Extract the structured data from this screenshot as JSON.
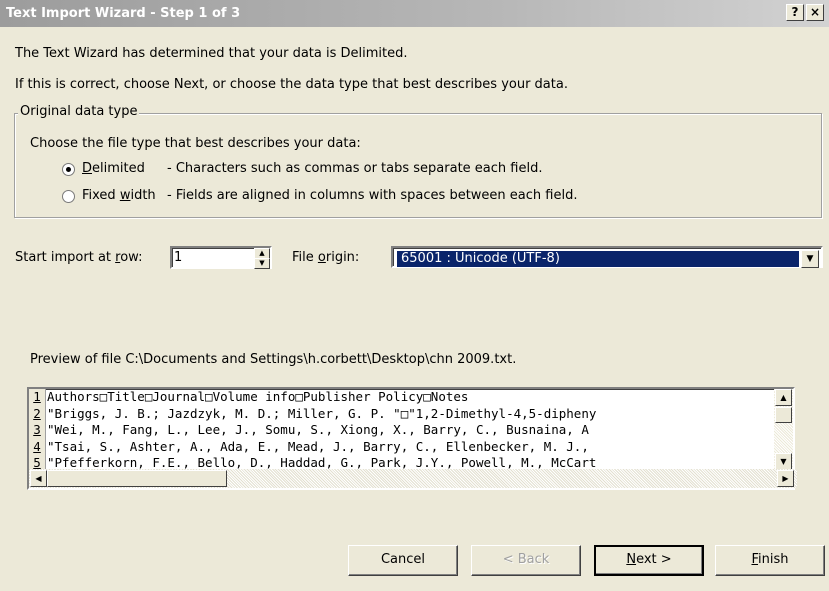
{
  "window": {
    "title": "Text Import Wizard - Step 1 of 3",
    "help_glyph": "?",
    "close_glyph": "×"
  },
  "intro": {
    "line1": "The Text Wizard has determined that your data is Delimited.",
    "line2": "If this is correct, choose Next, or choose the data type that best describes your data."
  },
  "original_data_type": {
    "legend": "Original data type",
    "prompt": "Choose the file type that best describes your data:",
    "options": [
      {
        "label_pre": "",
        "label_mnemonic": "D",
        "label_post": "elimited",
        "description": "- Characters such as commas or tabs separate each field.",
        "selected": true
      },
      {
        "label_pre": "Fixed ",
        "label_mnemonic": "w",
        "label_post": "idth",
        "description": "- Fields are aligned in columns with spaces between each field.",
        "selected": false
      }
    ]
  },
  "start_row": {
    "label_pre": "Start import at ",
    "label_mnemonic": "r",
    "label_post": "ow:",
    "value": "1"
  },
  "file_origin": {
    "label_pre": "File ",
    "label_mnemonic": "o",
    "label_post": "rigin:",
    "value": "65001 : Unicode (UTF-8)"
  },
  "preview": {
    "label": "Preview of file C:\\Documents and Settings\\h.corbett\\Desktop\\chn 2009.txt.",
    "rows": [
      {
        "num": "1",
        "text": "Authors□Title□Journal□Volume info□Publisher Policy□Notes"
      },
      {
        "num": "2",
        "text": "\"Briggs, J. B.; Jazdzyk, M. D.; Miller, G. P. \"□\"1,2-Dimethyl-4,5-dipheny"
      },
      {
        "num": "3",
        "text": "\"Wei, M., Fang, L., Lee, J., Somu, S., Xiong, X., Barry, C., Busnaina, A"
      },
      {
        "num": "4",
        "text": "\"Tsai, S., Ashter, A., Ada, E., Mead, J., Barry, C., Ellenbecker, M. J.,"
      },
      {
        "num": "5",
        "text": "\"Pfefferkorn, F.E., Bello, D., Haddad, G., Park, J.Y., Powell, M., McCart"
      }
    ]
  },
  "buttons": {
    "cancel": "Cancel",
    "back": "< Back",
    "next_mnemonic": "N",
    "next_post": "ext >",
    "finish_mnemonic": "F",
    "finish_post": "inish"
  }
}
